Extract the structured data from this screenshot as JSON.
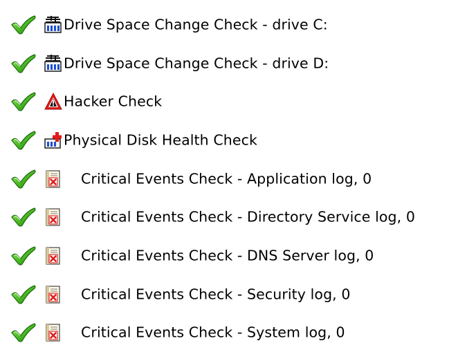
{
  "checks": [
    {
      "icon": "disk-space-icon",
      "status": "pass",
      "label": "Drive Space Change Check - drive C:"
    },
    {
      "icon": "disk-space-icon",
      "status": "pass",
      "label": "Drive Space Change Check - drive D:"
    },
    {
      "icon": "hacker-warning-icon",
      "status": "pass",
      "label": "Hacker Check"
    },
    {
      "icon": "disk-health-icon",
      "status": "pass",
      "label": "Physical Disk Health Check"
    },
    {
      "icon": "event-log-icon",
      "status": "pass",
      "label": "Critical Events Check - Application log, 0"
    },
    {
      "icon": "event-log-icon",
      "status": "pass",
      "label": "Critical Events Check - Directory Service log, 0"
    },
    {
      "icon": "event-log-icon",
      "status": "pass",
      "label": "Critical Events Check - DNS Server log, 0"
    },
    {
      "icon": "event-log-icon",
      "status": "pass",
      "label": "Critical Events Check - Security log, 0"
    },
    {
      "icon": "event-log-icon",
      "status": "pass",
      "label": "Critical Events Check - System log, 0"
    }
  ],
  "colors": {
    "check_green": "#3aa51c",
    "alert_red": "#e11b1b",
    "bar_blue": "#1d4fd6",
    "text": "#000000"
  }
}
